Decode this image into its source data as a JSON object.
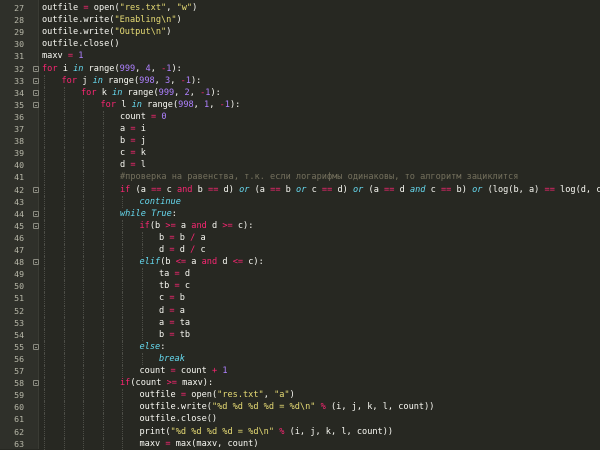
{
  "colors": {
    "background": "#272822",
    "gutter": "#2f302a",
    "plain": "#f8f8f2",
    "keyword": "#f92672",
    "italic_keyword": "#66d9ef",
    "string": "#e6db74",
    "number": "#ae81ff",
    "comment": "#75715e"
  },
  "lines": [
    {
      "n": "27",
      "indent": 0,
      "fold": false,
      "t": [
        [
          "tx",
          "outfile "
        ],
        [
          "op",
          "="
        ],
        [
          "tx",
          " open("
        ],
        [
          "st",
          "\"res.txt\""
        ],
        [
          "tx",
          ", "
        ],
        [
          "st",
          "\"w\""
        ],
        [
          "tx",
          ")"
        ]
      ]
    },
    {
      "n": "28",
      "indent": 0,
      "fold": false,
      "t": [
        [
          "tx",
          "outfile.write("
        ],
        [
          "st",
          "\"Enabling\\n\""
        ],
        [
          "tx",
          ")"
        ]
      ]
    },
    {
      "n": "29",
      "indent": 0,
      "fold": false,
      "t": [
        [
          "tx",
          "outfile.write("
        ],
        [
          "st",
          "\"Output\\n\""
        ],
        [
          "tx",
          ")"
        ]
      ]
    },
    {
      "n": "30",
      "indent": 0,
      "fold": false,
      "t": [
        [
          "tx",
          "outfile.close()"
        ]
      ]
    },
    {
      "n": "31",
      "indent": 0,
      "fold": false,
      "t": [
        [
          "tx",
          "maxv "
        ],
        [
          "op",
          "="
        ],
        [
          "tx",
          " "
        ],
        [
          "nu",
          "1"
        ]
      ]
    },
    {
      "n": "32",
      "indent": 0,
      "fold": true,
      "t": [
        [
          "kw",
          "for"
        ],
        [
          "tx",
          " i "
        ],
        [
          "it",
          "in"
        ],
        [
          "tx",
          " range("
        ],
        [
          "nu",
          "999"
        ],
        [
          "tx",
          ", "
        ],
        [
          "nu",
          "4"
        ],
        [
          "tx",
          ", "
        ],
        [
          "op",
          "-"
        ],
        [
          "nu",
          "1"
        ],
        [
          "tx",
          "):"
        ]
      ]
    },
    {
      "n": "33",
      "indent": 1,
      "fold": true,
      "t": [
        [
          "kw",
          "for"
        ],
        [
          "tx",
          " j "
        ],
        [
          "it",
          "in"
        ],
        [
          "tx",
          " range("
        ],
        [
          "nu",
          "998"
        ],
        [
          "tx",
          ", "
        ],
        [
          "nu",
          "3"
        ],
        [
          "tx",
          ", "
        ],
        [
          "op",
          "-"
        ],
        [
          "nu",
          "1"
        ],
        [
          "tx",
          "):"
        ]
      ]
    },
    {
      "n": "34",
      "indent": 2,
      "fold": true,
      "t": [
        [
          "kw",
          "for"
        ],
        [
          "tx",
          " k "
        ],
        [
          "it",
          "in"
        ],
        [
          "tx",
          " range("
        ],
        [
          "nu",
          "999"
        ],
        [
          "tx",
          ", "
        ],
        [
          "nu",
          "2"
        ],
        [
          "tx",
          ", "
        ],
        [
          "op",
          "-"
        ],
        [
          "nu",
          "1"
        ],
        [
          "tx",
          "):"
        ]
      ]
    },
    {
      "n": "35",
      "indent": 3,
      "fold": true,
      "t": [
        [
          "kw",
          "for"
        ],
        [
          "tx",
          " l "
        ],
        [
          "it",
          "in"
        ],
        [
          "tx",
          " range("
        ],
        [
          "nu",
          "998"
        ],
        [
          "tx",
          ", "
        ],
        [
          "nu",
          "1"
        ],
        [
          "tx",
          ", "
        ],
        [
          "op",
          "-"
        ],
        [
          "nu",
          "1"
        ],
        [
          "tx",
          "):"
        ]
      ]
    },
    {
      "n": "36",
      "indent": 4,
      "fold": false,
      "t": [
        [
          "tx",
          "count "
        ],
        [
          "op",
          "="
        ],
        [
          "tx",
          " "
        ],
        [
          "nu",
          "0"
        ]
      ]
    },
    {
      "n": "37",
      "indent": 4,
      "fold": false,
      "t": [
        [
          "tx",
          "a "
        ],
        [
          "op",
          "="
        ],
        [
          "tx",
          " i"
        ]
      ]
    },
    {
      "n": "38",
      "indent": 4,
      "fold": false,
      "t": [
        [
          "tx",
          "b "
        ],
        [
          "op",
          "="
        ],
        [
          "tx",
          " j"
        ]
      ]
    },
    {
      "n": "39",
      "indent": 4,
      "fold": false,
      "t": [
        [
          "tx",
          "c "
        ],
        [
          "op",
          "="
        ],
        [
          "tx",
          " k"
        ]
      ]
    },
    {
      "n": "40",
      "indent": 4,
      "fold": false,
      "t": [
        [
          "tx",
          "d "
        ],
        [
          "op",
          "="
        ],
        [
          "tx",
          " l"
        ]
      ]
    },
    {
      "n": "41",
      "indent": 4,
      "fold": false,
      "t": [
        [
          "cm",
          "#проверка на равенства, т.к. если логарифмы одинаковы, то алгоритм зациклится"
        ]
      ]
    },
    {
      "n": "42",
      "indent": 4,
      "fold": true,
      "t": [
        [
          "kw",
          "if"
        ],
        [
          "tx",
          " (a "
        ],
        [
          "op",
          "=="
        ],
        [
          "tx",
          " c "
        ],
        [
          "kw",
          "and"
        ],
        [
          "tx",
          " b "
        ],
        [
          "op",
          "=="
        ],
        [
          "tx",
          " d) "
        ],
        [
          "it",
          "or"
        ],
        [
          "tx",
          " (a "
        ],
        [
          "op",
          "=="
        ],
        [
          "tx",
          " b "
        ],
        [
          "it",
          "or"
        ],
        [
          "tx",
          " c "
        ],
        [
          "op",
          "=="
        ],
        [
          "tx",
          " d) "
        ],
        [
          "it",
          "or"
        ],
        [
          "tx",
          " (a "
        ],
        [
          "op",
          "=="
        ],
        [
          "tx",
          " d "
        ],
        [
          "it",
          "and"
        ],
        [
          "tx",
          " c "
        ],
        [
          "op",
          "=="
        ],
        [
          "tx",
          " b) "
        ],
        [
          "it",
          "or"
        ],
        [
          "tx",
          " (log(b, a) "
        ],
        [
          "op",
          "=="
        ],
        [
          "tx",
          " log(d, c)):"
        ]
      ]
    },
    {
      "n": "43",
      "indent": 5,
      "fold": false,
      "t": [
        [
          "it",
          "continue"
        ]
      ]
    },
    {
      "n": "44",
      "indent": 4,
      "fold": true,
      "t": [
        [
          "it",
          "while"
        ],
        [
          "tx",
          " "
        ],
        [
          "it",
          "True"
        ],
        [
          "tx",
          ":"
        ]
      ]
    },
    {
      "n": "45",
      "indent": 5,
      "fold": true,
      "t": [
        [
          "kw",
          "if"
        ],
        [
          "tx",
          "(b "
        ],
        [
          "op",
          ">="
        ],
        [
          "tx",
          " a "
        ],
        [
          "kw",
          "and"
        ],
        [
          "tx",
          " d "
        ],
        [
          "op",
          ">="
        ],
        [
          "tx",
          " c):"
        ]
      ]
    },
    {
      "n": "46",
      "indent": 6,
      "fold": false,
      "t": [
        [
          "tx",
          "b "
        ],
        [
          "op",
          "="
        ],
        [
          "tx",
          " b "
        ],
        [
          "op",
          "/"
        ],
        [
          "tx",
          " a"
        ]
      ]
    },
    {
      "n": "47",
      "indent": 6,
      "fold": false,
      "t": [
        [
          "tx",
          "d "
        ],
        [
          "op",
          "="
        ],
        [
          "tx",
          " d "
        ],
        [
          "op",
          "/"
        ],
        [
          "tx",
          " c"
        ]
      ]
    },
    {
      "n": "48",
      "indent": 5,
      "fold": true,
      "t": [
        [
          "it",
          "elif"
        ],
        [
          "tx",
          "(b "
        ],
        [
          "op",
          "<="
        ],
        [
          "tx",
          " a "
        ],
        [
          "kw",
          "and"
        ],
        [
          "tx",
          " d "
        ],
        [
          "op",
          "<="
        ],
        [
          "tx",
          " c):"
        ]
      ]
    },
    {
      "n": "49",
      "indent": 6,
      "fold": false,
      "t": [
        [
          "tx",
          "ta "
        ],
        [
          "op",
          "="
        ],
        [
          "tx",
          " d"
        ]
      ]
    },
    {
      "n": "50",
      "indent": 6,
      "fold": false,
      "t": [
        [
          "tx",
          "tb "
        ],
        [
          "op",
          "="
        ],
        [
          "tx",
          " c"
        ]
      ]
    },
    {
      "n": "51",
      "indent": 6,
      "fold": false,
      "t": [
        [
          "tx",
          "c "
        ],
        [
          "op",
          "="
        ],
        [
          "tx",
          " b"
        ]
      ]
    },
    {
      "n": "52",
      "indent": 6,
      "fold": false,
      "t": [
        [
          "tx",
          "d "
        ],
        [
          "op",
          "="
        ],
        [
          "tx",
          " a"
        ]
      ]
    },
    {
      "n": "53",
      "indent": 6,
      "fold": false,
      "t": [
        [
          "tx",
          "a "
        ],
        [
          "op",
          "="
        ],
        [
          "tx",
          " ta"
        ]
      ]
    },
    {
      "n": "54",
      "indent": 6,
      "fold": false,
      "t": [
        [
          "tx",
          "b "
        ],
        [
          "op",
          "="
        ],
        [
          "tx",
          " tb"
        ]
      ]
    },
    {
      "n": "55",
      "indent": 5,
      "fold": true,
      "t": [
        [
          "it",
          "else"
        ],
        [
          "tx",
          ":"
        ]
      ]
    },
    {
      "n": "56",
      "indent": 6,
      "fold": false,
      "t": [
        [
          "it",
          "break"
        ]
      ]
    },
    {
      "n": "57",
      "indent": 5,
      "fold": false,
      "t": [
        [
          "tx",
          "count "
        ],
        [
          "op",
          "="
        ],
        [
          "tx",
          " count "
        ],
        [
          "op",
          "+"
        ],
        [
          "tx",
          " "
        ],
        [
          "nu",
          "1"
        ]
      ]
    },
    {
      "n": "58",
      "indent": 4,
      "fold": true,
      "t": [
        [
          "kw",
          "if"
        ],
        [
          "tx",
          "(count "
        ],
        [
          "op",
          ">="
        ],
        [
          "tx",
          " maxv):"
        ]
      ]
    },
    {
      "n": "59",
      "indent": 5,
      "fold": false,
      "t": [
        [
          "tx",
          "outfile "
        ],
        [
          "op",
          "="
        ],
        [
          "tx",
          " open("
        ],
        [
          "st",
          "\"res.txt\""
        ],
        [
          "tx",
          ", "
        ],
        [
          "st",
          "\"a\""
        ],
        [
          "tx",
          ")"
        ]
      ]
    },
    {
      "n": "60",
      "indent": 5,
      "fold": false,
      "t": [
        [
          "tx",
          "outfile.write("
        ],
        [
          "st",
          "\"%d %d %d %d = %d\\n\""
        ],
        [
          "tx",
          " "
        ],
        [
          "op",
          "%"
        ],
        [
          "tx",
          " (i, j, k, l, count))"
        ]
      ]
    },
    {
      "n": "61",
      "indent": 5,
      "fold": false,
      "t": [
        [
          "tx",
          "outfile.close()"
        ]
      ]
    },
    {
      "n": "62",
      "indent": 5,
      "fold": false,
      "t": [
        [
          "tx",
          "print("
        ],
        [
          "st",
          "\"%d %d %d %d = %d\\n\""
        ],
        [
          "tx",
          " "
        ],
        [
          "op",
          "%"
        ],
        [
          "tx",
          " (i, j, k, l, count))"
        ]
      ]
    },
    {
      "n": "63",
      "indent": 5,
      "fold": false,
      "t": [
        [
          "tx",
          "maxv "
        ],
        [
          "op",
          "="
        ],
        [
          "tx",
          " max(maxv, count)"
        ]
      ]
    }
  ]
}
